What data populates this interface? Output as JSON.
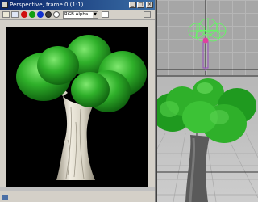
{
  "render_window": {
    "title": "Perspective, frame 0 (1:1)",
    "channel_select": {
      "value": "RGB Alpha"
    },
    "toolbar_icons": [
      "save-icon",
      "clone-icon",
      "red-channel-icon",
      "green-channel-icon",
      "blue-channel-icon",
      "alpha-channel-icon",
      "mono-icon",
      "clear-icon"
    ],
    "title_buttons": {
      "minimize": "_",
      "maximize": "□",
      "close": "×"
    }
  },
  "colors": {
    "canvas_bg": "#000000",
    "foliage": "#2fb02a",
    "trunk": "#d8d3c4",
    "title_bar": "#0a246a",
    "selected_wire": "#5dff5d",
    "selected_pivot": "#e040a0"
  },
  "viewports": [
    "top",
    "perspective"
  ]
}
